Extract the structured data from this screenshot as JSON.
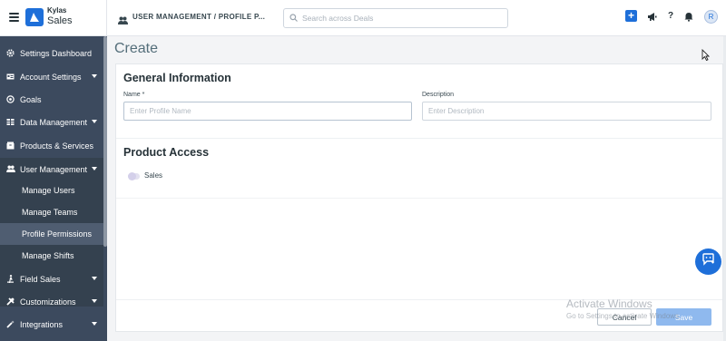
{
  "app": {
    "brand_top": "Kylas",
    "brand_bottom": "Sales"
  },
  "topbar": {
    "breadcrumb": "USER MANAGEMENT / PROFILE P...",
    "search_placeholder": "Search across Deals",
    "avatar_initial": "R",
    "help_label": "?",
    "plus_label": "+"
  },
  "sidebar": {
    "items": [
      {
        "label": "Settings Dashboard",
        "icon": "gear-icon"
      },
      {
        "label": "Account Settings",
        "icon": "id-card-icon",
        "expandable": true
      },
      {
        "label": "Goals",
        "icon": "target-icon"
      },
      {
        "label": "Data Management",
        "icon": "table-icon",
        "expandable": true
      },
      {
        "label": "Products & Services",
        "icon": "box-icon"
      },
      {
        "label": "User Management",
        "icon": "users-icon",
        "expandable": true,
        "expanded": true
      },
      {
        "label": "Field Sales",
        "icon": "walking-icon",
        "expandable": true
      },
      {
        "label": "Customizations",
        "icon": "tools-icon",
        "expandable": true
      },
      {
        "label": "Integrations",
        "icon": "magic-wand-icon",
        "expandable": true
      }
    ],
    "subitems": [
      {
        "label": "Manage Users"
      },
      {
        "label": "Manage Teams"
      },
      {
        "label": "Profile Permissions",
        "active": true
      },
      {
        "label": "Manage Shifts"
      }
    ]
  },
  "page": {
    "title": "Create"
  },
  "general": {
    "title": "General Information",
    "name_label": "Name *",
    "name_placeholder": "Enter Profile Name",
    "description_label": "Description",
    "description_placeholder": "Enter Description"
  },
  "product_access": {
    "title": "Product Access",
    "toggle_label": "Sales",
    "toggle_on": false
  },
  "footer": {
    "cancel_label": "Cancel",
    "save_label": "Save"
  },
  "watermark": {
    "line1": "Activate Windows",
    "line2": "Go to Settings to activate Windows."
  },
  "colors": {
    "accent": "#1e6fd9",
    "sidebar_bg": "#3c4a5e",
    "save_disabled": "#8fb9ee"
  }
}
